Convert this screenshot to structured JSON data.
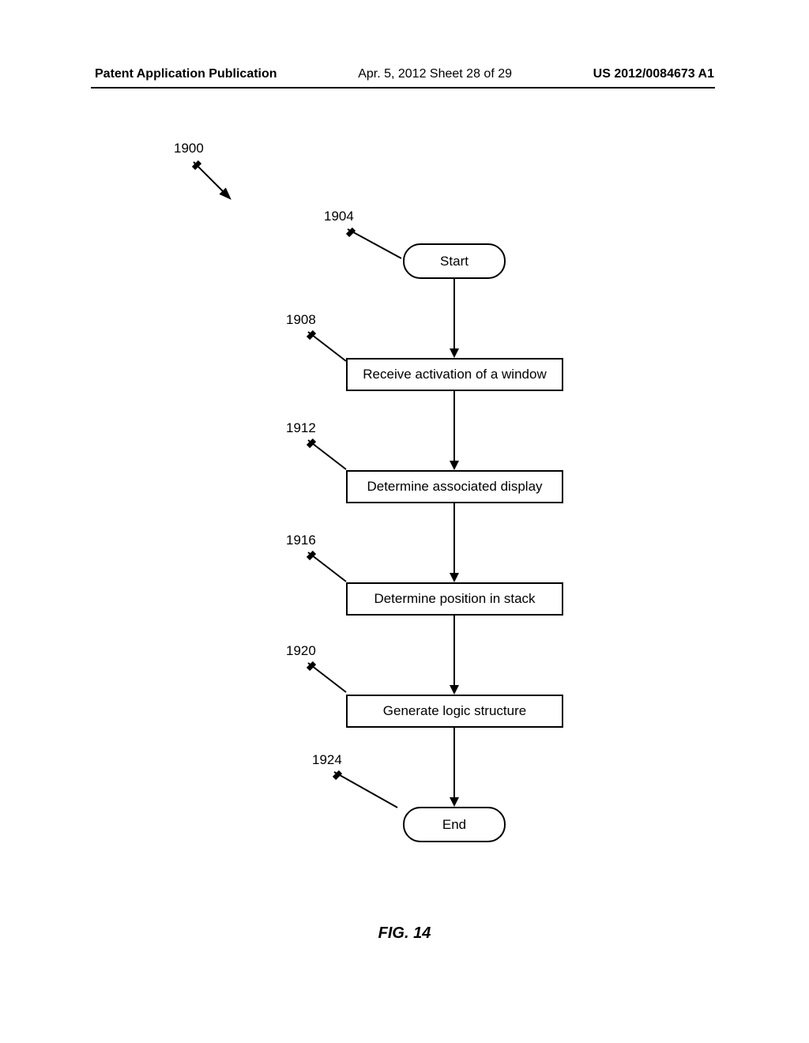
{
  "header": {
    "left": "Patent Application Publication",
    "center": "Apr. 5, 2012  Sheet 28 of 29",
    "right": "US 2012/0084673 A1"
  },
  "labels": {
    "l1900": "1900",
    "l1904": "1904",
    "l1908": "1908",
    "l1912": "1912",
    "l1916": "1916",
    "l1920": "1920",
    "l1924": "1924"
  },
  "flowchart": {
    "start": "Start",
    "step1": "Receive activation of a window",
    "step2": "Determine associated display",
    "step3": "Determine position in stack",
    "step4": "Generate logic structure",
    "end": "End"
  },
  "caption": "FIG. 14"
}
